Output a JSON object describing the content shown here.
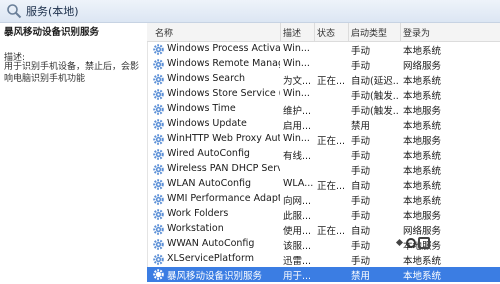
{
  "window": {
    "title": "服务(本地)"
  },
  "details": {
    "service_name": "暴风移动设备识别服务",
    "description_label": "描述:",
    "description": "用于识别手机设备，禁止后，会影响电脑识别手机功能"
  },
  "columns": {
    "name": "名称",
    "description": "描述",
    "status": "状态",
    "startup": "启动类型",
    "logon": "登录为"
  },
  "services": [
    {
      "name": "Windows Process Activati...",
      "description": "Win...",
      "status": "",
      "startup": "手动",
      "logon": "本地系统"
    },
    {
      "name": "Windows Remote Manag...",
      "description": "Win...",
      "status": "",
      "startup": "手动",
      "logon": "网络服务"
    },
    {
      "name": "Windows Search",
      "description": "为文...",
      "status": "正在...",
      "startup": "自动(延迟...",
      "logon": "本地系统"
    },
    {
      "name": "Windows Store Service (...",
      "description": "Win...",
      "status": "",
      "startup": "手动(触发...",
      "logon": "本地系统"
    },
    {
      "name": "Windows Time",
      "description": "维护...",
      "status": "",
      "startup": "手动(触发...",
      "logon": "本地服务"
    },
    {
      "name": "Windows Update",
      "description": "启用...",
      "status": "",
      "startup": "禁用",
      "logon": "本地系统"
    },
    {
      "name": "WinHTTP Web Proxy Aut...",
      "description": "Win...",
      "status": "正在...",
      "startup": "手动",
      "logon": "本地服务"
    },
    {
      "name": "Wired AutoConfig",
      "description": "有线...",
      "status": "",
      "startup": "手动",
      "logon": "本地系统"
    },
    {
      "name": "Wireless PAN DHCP Server",
      "description": "",
      "status": "",
      "startup": "手动",
      "logon": "本地系统"
    },
    {
      "name": "WLAN AutoConfig",
      "description": "WLA...",
      "status": "正在...",
      "startup": "自动",
      "logon": "本地系统"
    },
    {
      "name": "WMI Performance Adapt...",
      "description": "向网...",
      "status": "",
      "startup": "手动",
      "logon": "本地系统"
    },
    {
      "name": "Work Folders",
      "description": "此服...",
      "status": "",
      "startup": "手动",
      "logon": "本地服务"
    },
    {
      "name": "Workstation",
      "description": "使用...",
      "status": "正在...",
      "startup": "自动",
      "logon": "网络服务"
    },
    {
      "name": "WWAN AutoConfig",
      "description": "该服...",
      "status": "",
      "startup": "手动",
      "logon": "本地服务"
    },
    {
      "name": "XLServicePlatform",
      "description": "迅雷...",
      "status": "",
      "startup": "手动",
      "logon": "本地系统"
    },
    {
      "name": "暴风移动设备识别服务",
      "description": "用于...",
      "status": "",
      "startup": "禁用",
      "logon": "本地系统",
      "selected": true
    }
  ],
  "colors": {
    "selection": "#3b7de3",
    "header_bg": "#eef3fa",
    "gear_icon": "#5b8fd6"
  }
}
